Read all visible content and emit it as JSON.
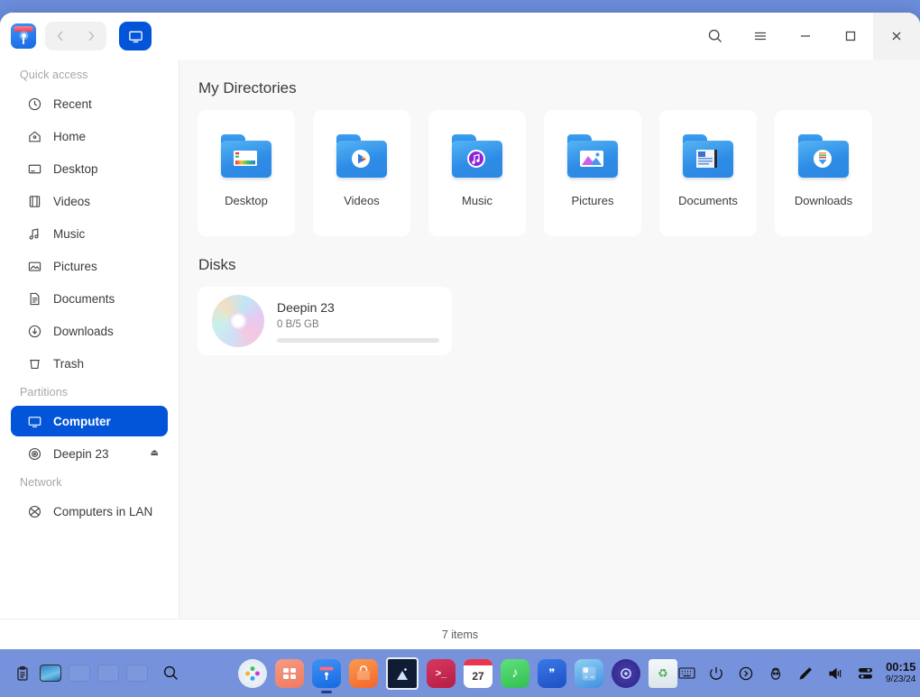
{
  "window": {
    "app_icon": "file-manager-icon",
    "nav": {
      "back": "‹",
      "forward": "›",
      "view_mode": "computer-view-icon"
    },
    "controls": {
      "search": "search-icon",
      "menu": "hamburger-menu-icon",
      "minimize": "minimize-icon",
      "maximize": "maximize-icon",
      "close": "close-icon"
    }
  },
  "sidebar": {
    "sections": [
      {
        "title": "Quick access",
        "items": [
          {
            "label": "Recent",
            "icon": "clock-icon",
            "active": false
          },
          {
            "label": "Home",
            "icon": "home-icon",
            "active": false
          },
          {
            "label": "Desktop",
            "icon": "desktop-icon",
            "active": false
          },
          {
            "label": "Videos",
            "icon": "film-icon",
            "active": false
          },
          {
            "label": "Music",
            "icon": "music-note-icon",
            "active": false
          },
          {
            "label": "Pictures",
            "icon": "image-icon",
            "active": false
          },
          {
            "label": "Documents",
            "icon": "document-icon",
            "active": false
          },
          {
            "label": "Downloads",
            "icon": "download-icon",
            "active": false
          },
          {
            "label": "Trash",
            "icon": "trash-icon",
            "active": false
          }
        ]
      },
      {
        "title": "Partitions",
        "items": [
          {
            "label": "Computer",
            "icon": "monitor-icon",
            "active": true
          },
          {
            "label": "Deepin 23",
            "icon": "disc-icon",
            "active": false,
            "eject": "⏏"
          }
        ]
      },
      {
        "title": "Network",
        "items": [
          {
            "label": "Computers in LAN",
            "icon": "network-globe-icon",
            "active": false
          }
        ]
      }
    ]
  },
  "main": {
    "directories_heading": "My Directories",
    "directories": [
      {
        "name": "Desktop",
        "icon": "folder-desktop-icon"
      },
      {
        "name": "Videos",
        "icon": "folder-videos-icon"
      },
      {
        "name": "Music",
        "icon": "folder-music-icon"
      },
      {
        "name": "Pictures",
        "icon": "folder-pictures-icon"
      },
      {
        "name": "Documents",
        "icon": "folder-documents-icon"
      },
      {
        "name": "Downloads",
        "icon": "folder-downloads-icon"
      }
    ],
    "disks_heading": "Disks",
    "disks": [
      {
        "name": "Deepin 23",
        "usage": "0 B/5 GB",
        "used_percent": 0,
        "icon": "optical-disc-icon"
      }
    ]
  },
  "statusbar": {
    "items_count": "7 items"
  },
  "taskbar": {
    "left": [
      {
        "name": "clipboard-icon"
      },
      {
        "name": "workspace-1",
        "active": true
      },
      {
        "name": "workspace-2",
        "active": false
      },
      {
        "name": "workspace-3",
        "active": false
      },
      {
        "name": "workspace-4",
        "active": false
      },
      {
        "name": "search-icon"
      }
    ],
    "apps": [
      {
        "name": "launcher-icon",
        "glyph": "",
        "color": "#eef2f6",
        "running": false
      },
      {
        "name": "app-grid-icon",
        "glyph": "",
        "color": "#f2836f",
        "running": false
      },
      {
        "name": "file-manager-icon",
        "glyph": "",
        "color": "#2474dd",
        "running": true
      },
      {
        "name": "app-store-icon",
        "glyph": "",
        "color": "#f4803a",
        "running": false
      },
      {
        "name": "image-viewer-icon",
        "glyph": "",
        "color": "#14203a",
        "running": false
      },
      {
        "name": "terminal-icon",
        "glyph": ">_",
        "color": "#c7234a",
        "running": false
      },
      {
        "name": "calendar-icon",
        "glyph": "27",
        "color": "#fdfdfd",
        "running": false
      },
      {
        "name": "music-player-icon",
        "glyph": "♪",
        "color": "#4cd266",
        "running": false
      },
      {
        "name": "notes-icon",
        "glyph": "❞",
        "color": "#2a63d8",
        "running": false
      },
      {
        "name": "calculator-icon",
        "glyph": "",
        "color": "#3f8fe0",
        "running": false
      },
      {
        "name": "control-center-icon",
        "glyph": "",
        "color": "#3d2f8f",
        "running": false
      },
      {
        "name": "trash-icon",
        "glyph": "♻",
        "color": "#e9eef2",
        "running": false
      }
    ],
    "tray": [
      {
        "name": "keyboard-icon",
        "glyph": "⌨"
      },
      {
        "name": "power-icon",
        "glyph": "⏻"
      },
      {
        "name": "arrow-circle-icon",
        "glyph": "❯"
      },
      {
        "name": "onboard-icon",
        "glyph": "☻"
      },
      {
        "name": "pen-icon",
        "glyph": "✒"
      },
      {
        "name": "volume-icon",
        "glyph": "🔊"
      },
      {
        "name": "control-center-tray-icon",
        "glyph": "☰"
      }
    ],
    "clock": {
      "time": "00:15",
      "date": "9/23/24"
    }
  },
  "colors": {
    "accent": "#0254d8",
    "desktop_top": "#6b8ddb",
    "taskbar": "#7a96de"
  }
}
